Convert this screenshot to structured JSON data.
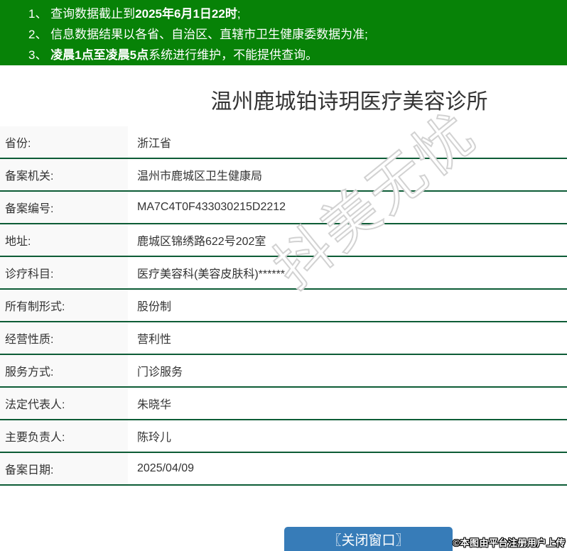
{
  "notice": {
    "line1": {
      "pre": "1、 查询数据截止到",
      "bold": "2025年6月1日22时",
      "post": ";"
    },
    "line2": {
      "pre": "2、 信息数据结果以各省、自治区、直辖市卫生健康委数据为准;",
      "bold": "",
      "post": ""
    },
    "line3": {
      "pre": "3、 ",
      "bold": "凌晨1点至凌晨5点",
      "post": "系统进行维护，不能提供查询。"
    }
  },
  "title": "温州鹿城铂诗玥医疗美容诊所",
  "table": {
    "rows": [
      {
        "label": "省份:",
        "value": "浙江省"
      },
      {
        "label": "备案机关:",
        "value": "温州市鹿城区卫生健康局"
      },
      {
        "label": "备案编号:",
        "value": "MA7C4T0F433030215D2212"
      },
      {
        "label": "地址:",
        "value": "鹿城区锦绣路622号202室"
      },
      {
        "label": "诊疗科目:",
        "value": "医疗美容科(美容皮肤科)******"
      },
      {
        "label": "所有制形式:",
        "value": "股份制"
      },
      {
        "label": "经营性质:",
        "value": "营利性"
      },
      {
        "label": "服务方式:",
        "value": "门诊服务"
      },
      {
        "label": "法定代表人:",
        "value": "朱晓华"
      },
      {
        "label": "主要负责人:",
        "value": "陈玲儿"
      },
      {
        "label": "备案日期:",
        "value": "2025/04/09"
      }
    ]
  },
  "button": {
    "close_label": "〖关闭窗口〗"
  },
  "watermark": {
    "center": "抖美无忧",
    "corner": "©本图由平台注册用户上传"
  },
  "colors": {
    "banner_green": "#078207",
    "divider_green": "#0d5c36",
    "button_blue": "#377cb8",
    "label_bg": "#f9f9f9",
    "text": "#333333"
  }
}
